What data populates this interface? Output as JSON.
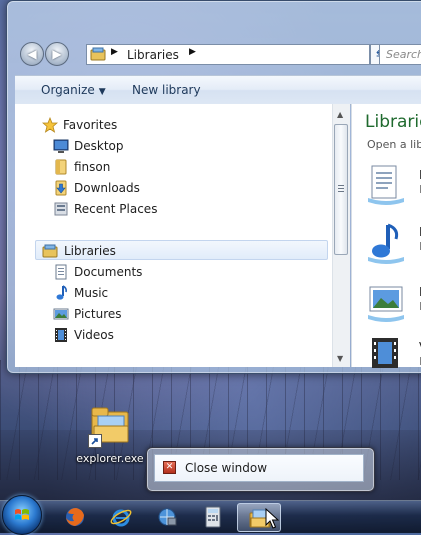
{
  "explorer": {
    "address": {
      "crumb": "Libraries"
    },
    "search": {
      "placeholder": "Search"
    },
    "toolbar": {
      "organize": "Organize",
      "new_library": "New library"
    },
    "tree": {
      "favorites": {
        "label": "Favorites",
        "items": [
          "Desktop",
          "finson",
          "Downloads",
          "Recent Places"
        ]
      },
      "libraries": {
        "label": "Libraries",
        "items": [
          "Documents",
          "Music",
          "Pictures",
          "Videos"
        ]
      }
    },
    "content": {
      "heading": "Librarie",
      "subheading": "Open a libra",
      "libraries": [
        {
          "name": "D",
          "type": "Li"
        },
        {
          "name": "M",
          "type": "Li"
        },
        {
          "name": "Pi",
          "type": "Li"
        },
        {
          "name": "Vi",
          "type": "Li"
        }
      ]
    }
  },
  "desktop": {
    "icon_label": "explorer.exe"
  },
  "jumplist": {
    "close_label": "Close window"
  },
  "colors": {
    "accent_green": "#1f6a2e",
    "toolbar_text": "#1e395b",
    "close_red": "#c0392b"
  }
}
